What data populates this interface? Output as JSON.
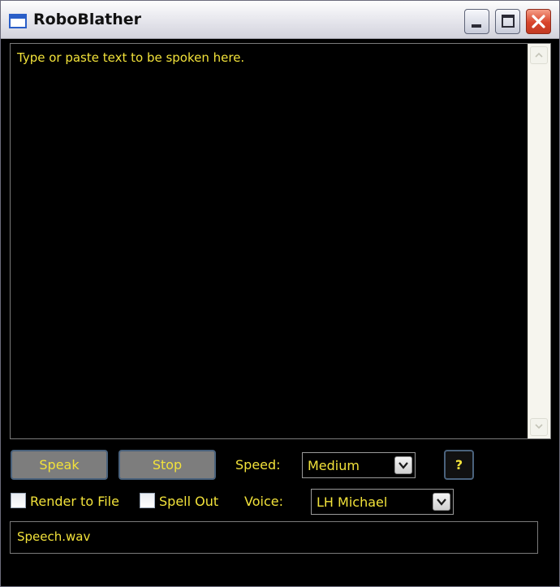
{
  "window": {
    "title": "RoboBlather"
  },
  "titlebar_buttons": {
    "minimize_icon": "minimize-icon",
    "maximize_icon": "maximize-icon",
    "close_icon": "close-icon"
  },
  "speech_text": {
    "placeholder": "Type or paste text to be spoken here.",
    "value": ""
  },
  "controls": {
    "speak_label": "Speak",
    "stop_label": "Stop",
    "speed_label": "Speed:",
    "speed_value": "Medium",
    "help_label": "?",
    "render_to_file_label": "Render to File",
    "render_to_file_checked": false,
    "spell_out_label": "Spell Out",
    "spell_out_checked": false,
    "voice_label": "Voice:",
    "voice_value": "LH Michael",
    "file_name": "Speech.wav"
  },
  "colors": {
    "background": "#000000",
    "text": "#f2e23a",
    "button_face": "#7d7d7d",
    "close_button": "#d8442b"
  }
}
